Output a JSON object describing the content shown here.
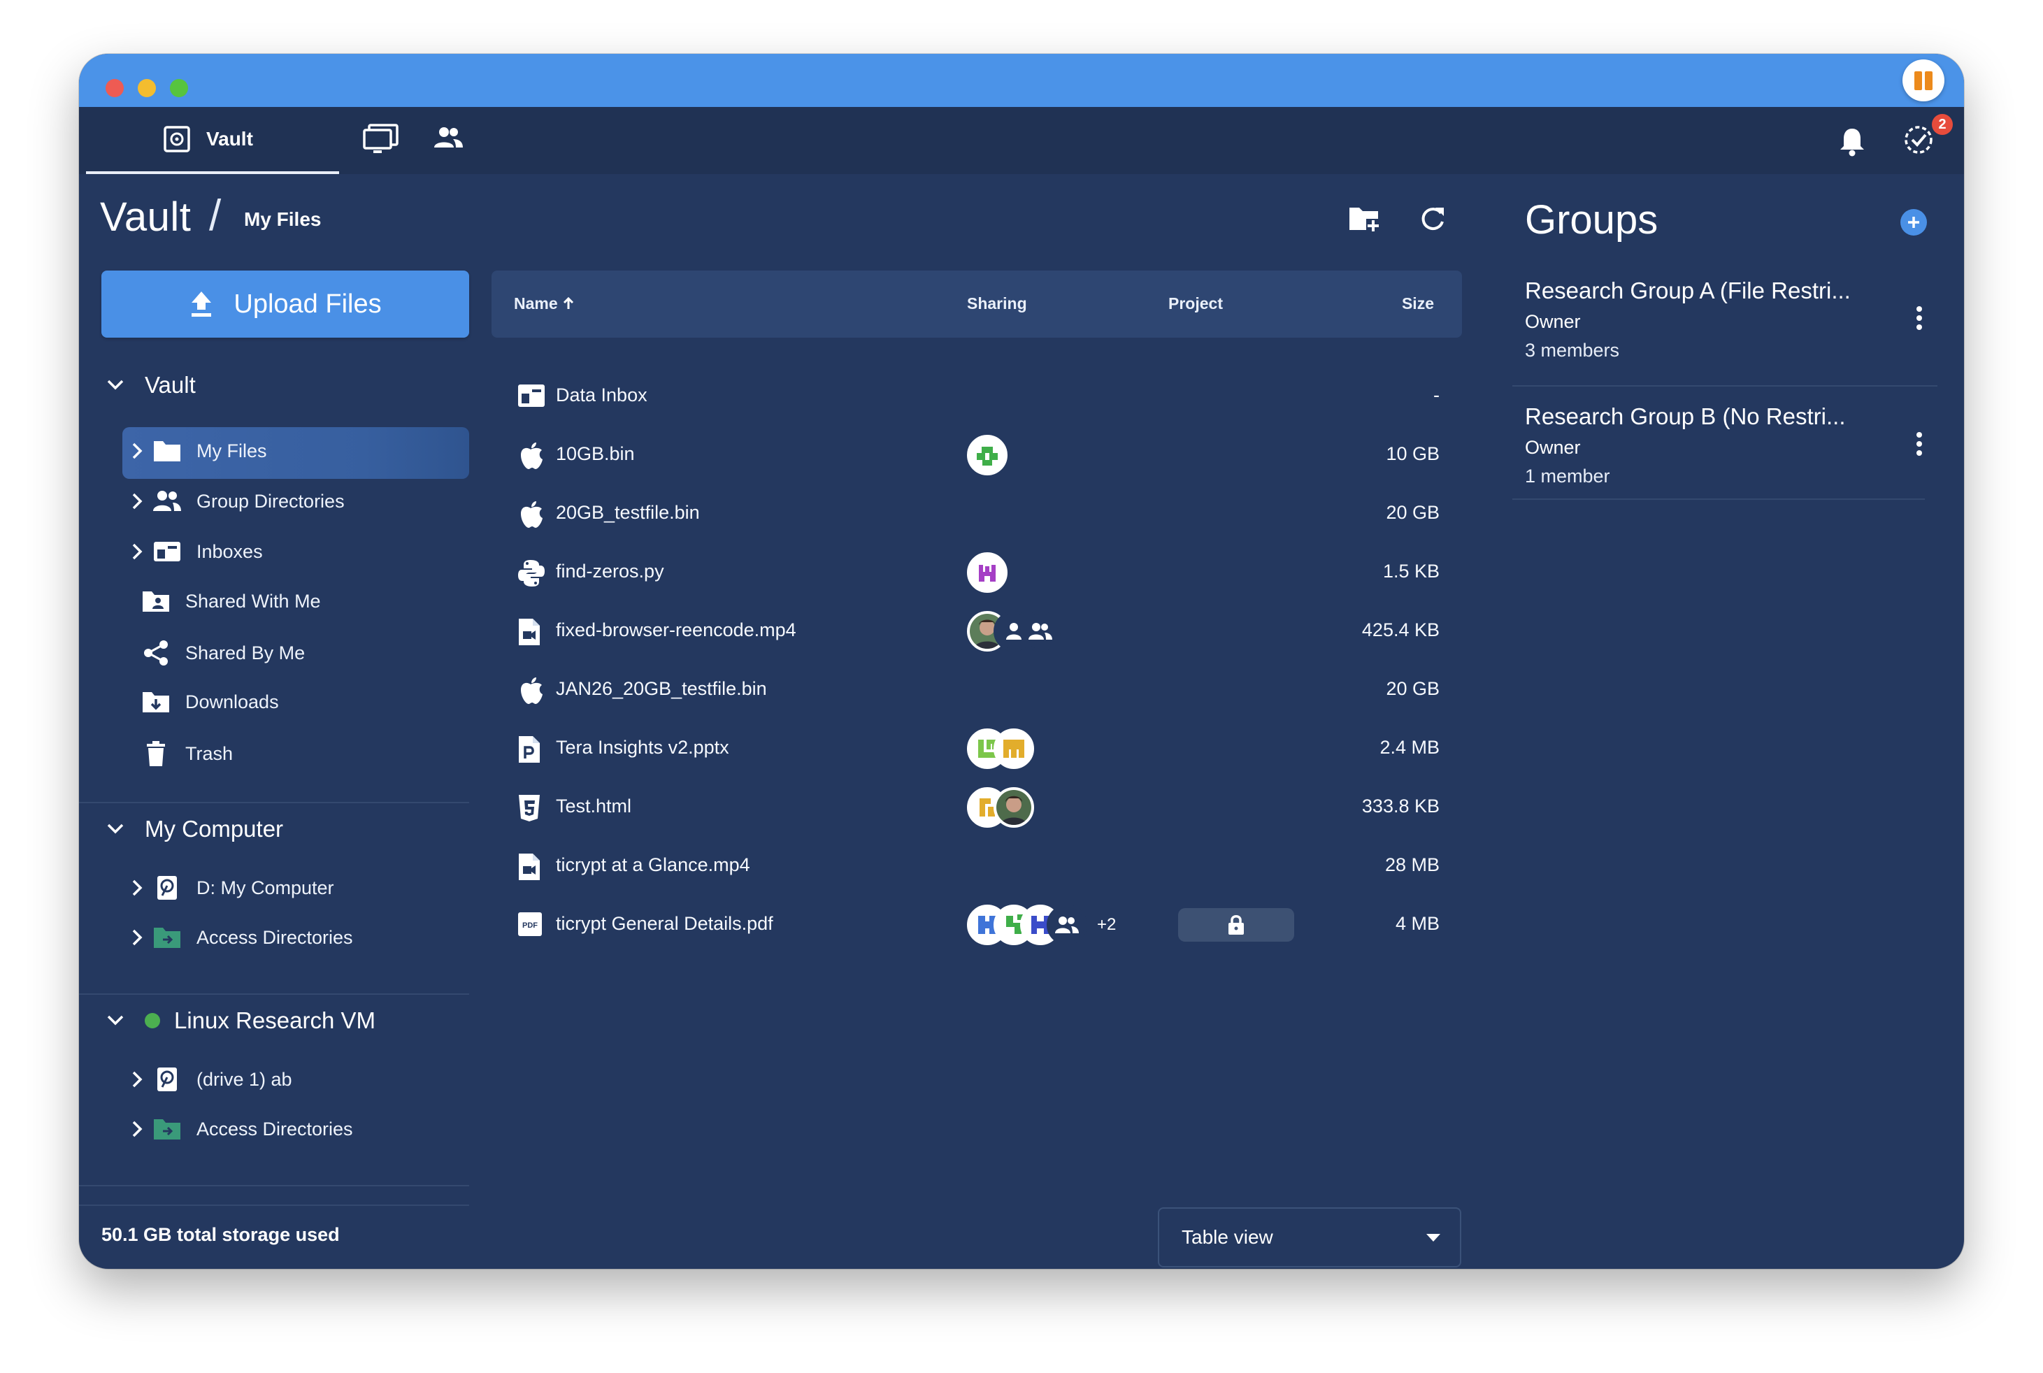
{
  "nav": {
    "vault_tab": "Vault",
    "notification_badge": "2"
  },
  "breadcrumb": {
    "root": "Vault",
    "separator": "/",
    "current": "My Files"
  },
  "sidebar": {
    "upload_label": "Upload Files",
    "vault_section": "Vault",
    "vault_items": [
      {
        "label": "My Files",
        "icon": "folder-icon"
      },
      {
        "label": "Group Directories",
        "icon": "people-icon"
      },
      {
        "label": "Inboxes",
        "icon": "inbox-icon"
      },
      {
        "label": "Shared With Me",
        "icon": "shared-folder-icon"
      },
      {
        "label": "Shared By Me",
        "icon": "share-icon"
      },
      {
        "label": "Downloads",
        "icon": "download-folder-icon"
      },
      {
        "label": "Trash",
        "icon": "trash-icon"
      }
    ],
    "computer_section": "My Computer",
    "computer_items": [
      {
        "label": "D: My Computer",
        "icon": "drive-icon"
      },
      {
        "label": "Access Directories",
        "icon": "access-folder-icon"
      }
    ],
    "vm_section": "Linux Research VM",
    "vm_items": [
      {
        "label": "(drive 1) ab",
        "icon": "drive-icon"
      },
      {
        "label": "Access Directories",
        "icon": "access-folder-icon"
      }
    ],
    "storage_text": "50.1 GB total storage used"
  },
  "table": {
    "columns": {
      "name": "Name",
      "sharing": "Sharing",
      "project": "Project",
      "size": "Size"
    },
    "rows": [
      {
        "name": "Data Inbox",
        "size": "-"
      },
      {
        "name": "10GB.bin",
        "size": "10 GB"
      },
      {
        "name": "20GB_testfile.bin",
        "size": "20 GB"
      },
      {
        "name": "find-zeros.py",
        "size": "1.5 KB"
      },
      {
        "name": "fixed-browser-reencode.mp4",
        "size": "425.4 KB"
      },
      {
        "name": "JAN26_20GB_testfile.bin",
        "size": "20 GB"
      },
      {
        "name": "Tera Insights v2.pptx",
        "size": "2.4 MB"
      },
      {
        "name": "Test.html",
        "size": "333.8 KB"
      },
      {
        "name": "ticrypt at a Glance.mp4",
        "size": "28 MB"
      },
      {
        "name": "ticrypt General Details.pdf",
        "size": "4 MB",
        "more_shares": "+2"
      }
    ]
  },
  "view_select": {
    "value": "Table view"
  },
  "groups": {
    "title": "Groups",
    "items": [
      {
        "name": "Research Group A (File Restri...",
        "role": "Owner",
        "members": "3 members"
      },
      {
        "name": "Research Group B (No Restri...",
        "role": "Owner",
        "members": "1 member"
      }
    ]
  },
  "colors": {
    "titlebar": "#4b93e8",
    "background": "#24385f",
    "accent": "#4a90e6",
    "online": "#4caf50",
    "badge": "#e74c3c"
  }
}
